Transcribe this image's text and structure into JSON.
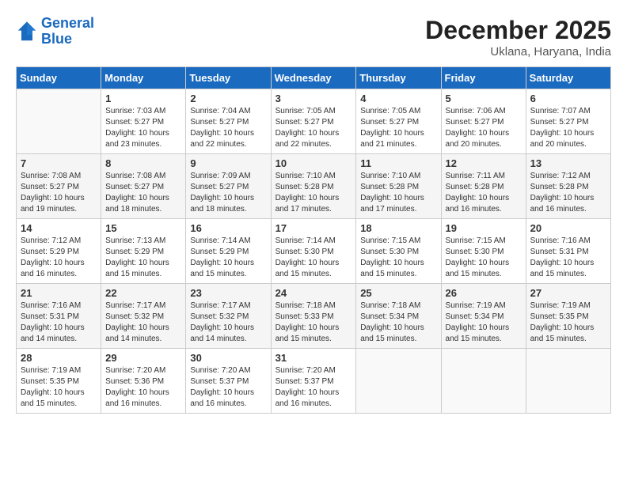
{
  "header": {
    "logo_line1": "General",
    "logo_line2": "Blue",
    "month": "December 2025",
    "location": "Uklana, Haryana, India"
  },
  "days_of_week": [
    "Sunday",
    "Monday",
    "Tuesday",
    "Wednesday",
    "Thursday",
    "Friday",
    "Saturday"
  ],
  "weeks": [
    [
      {
        "day": "",
        "info": ""
      },
      {
        "day": "1",
        "info": "Sunrise: 7:03 AM\nSunset: 5:27 PM\nDaylight: 10 hours\nand 23 minutes."
      },
      {
        "day": "2",
        "info": "Sunrise: 7:04 AM\nSunset: 5:27 PM\nDaylight: 10 hours\nand 22 minutes."
      },
      {
        "day": "3",
        "info": "Sunrise: 7:05 AM\nSunset: 5:27 PM\nDaylight: 10 hours\nand 22 minutes."
      },
      {
        "day": "4",
        "info": "Sunrise: 7:05 AM\nSunset: 5:27 PM\nDaylight: 10 hours\nand 21 minutes."
      },
      {
        "day": "5",
        "info": "Sunrise: 7:06 AM\nSunset: 5:27 PM\nDaylight: 10 hours\nand 20 minutes."
      },
      {
        "day": "6",
        "info": "Sunrise: 7:07 AM\nSunset: 5:27 PM\nDaylight: 10 hours\nand 20 minutes."
      }
    ],
    [
      {
        "day": "7",
        "info": "Sunrise: 7:08 AM\nSunset: 5:27 PM\nDaylight: 10 hours\nand 19 minutes."
      },
      {
        "day": "8",
        "info": "Sunrise: 7:08 AM\nSunset: 5:27 PM\nDaylight: 10 hours\nand 18 minutes."
      },
      {
        "day": "9",
        "info": "Sunrise: 7:09 AM\nSunset: 5:27 PM\nDaylight: 10 hours\nand 18 minutes."
      },
      {
        "day": "10",
        "info": "Sunrise: 7:10 AM\nSunset: 5:28 PM\nDaylight: 10 hours\nand 17 minutes."
      },
      {
        "day": "11",
        "info": "Sunrise: 7:10 AM\nSunset: 5:28 PM\nDaylight: 10 hours\nand 17 minutes."
      },
      {
        "day": "12",
        "info": "Sunrise: 7:11 AM\nSunset: 5:28 PM\nDaylight: 10 hours\nand 16 minutes."
      },
      {
        "day": "13",
        "info": "Sunrise: 7:12 AM\nSunset: 5:28 PM\nDaylight: 10 hours\nand 16 minutes."
      }
    ],
    [
      {
        "day": "14",
        "info": "Sunrise: 7:12 AM\nSunset: 5:29 PM\nDaylight: 10 hours\nand 16 minutes."
      },
      {
        "day": "15",
        "info": "Sunrise: 7:13 AM\nSunset: 5:29 PM\nDaylight: 10 hours\nand 15 minutes."
      },
      {
        "day": "16",
        "info": "Sunrise: 7:14 AM\nSunset: 5:29 PM\nDaylight: 10 hours\nand 15 minutes."
      },
      {
        "day": "17",
        "info": "Sunrise: 7:14 AM\nSunset: 5:30 PM\nDaylight: 10 hours\nand 15 minutes."
      },
      {
        "day": "18",
        "info": "Sunrise: 7:15 AM\nSunset: 5:30 PM\nDaylight: 10 hours\nand 15 minutes."
      },
      {
        "day": "19",
        "info": "Sunrise: 7:15 AM\nSunset: 5:30 PM\nDaylight: 10 hours\nand 15 minutes."
      },
      {
        "day": "20",
        "info": "Sunrise: 7:16 AM\nSunset: 5:31 PM\nDaylight: 10 hours\nand 15 minutes."
      }
    ],
    [
      {
        "day": "21",
        "info": "Sunrise: 7:16 AM\nSunset: 5:31 PM\nDaylight: 10 hours\nand 14 minutes."
      },
      {
        "day": "22",
        "info": "Sunrise: 7:17 AM\nSunset: 5:32 PM\nDaylight: 10 hours\nand 14 minutes."
      },
      {
        "day": "23",
        "info": "Sunrise: 7:17 AM\nSunset: 5:32 PM\nDaylight: 10 hours\nand 14 minutes."
      },
      {
        "day": "24",
        "info": "Sunrise: 7:18 AM\nSunset: 5:33 PM\nDaylight: 10 hours\nand 15 minutes."
      },
      {
        "day": "25",
        "info": "Sunrise: 7:18 AM\nSunset: 5:34 PM\nDaylight: 10 hours\nand 15 minutes."
      },
      {
        "day": "26",
        "info": "Sunrise: 7:19 AM\nSunset: 5:34 PM\nDaylight: 10 hours\nand 15 minutes."
      },
      {
        "day": "27",
        "info": "Sunrise: 7:19 AM\nSunset: 5:35 PM\nDaylight: 10 hours\nand 15 minutes."
      }
    ],
    [
      {
        "day": "28",
        "info": "Sunrise: 7:19 AM\nSunset: 5:35 PM\nDaylight: 10 hours\nand 15 minutes."
      },
      {
        "day": "29",
        "info": "Sunrise: 7:20 AM\nSunset: 5:36 PM\nDaylight: 10 hours\nand 16 minutes."
      },
      {
        "day": "30",
        "info": "Sunrise: 7:20 AM\nSunset: 5:37 PM\nDaylight: 10 hours\nand 16 minutes."
      },
      {
        "day": "31",
        "info": "Sunrise: 7:20 AM\nSunset: 5:37 PM\nDaylight: 10 hours\nand 16 minutes."
      },
      {
        "day": "",
        "info": ""
      },
      {
        "day": "",
        "info": ""
      },
      {
        "day": "",
        "info": ""
      }
    ]
  ]
}
